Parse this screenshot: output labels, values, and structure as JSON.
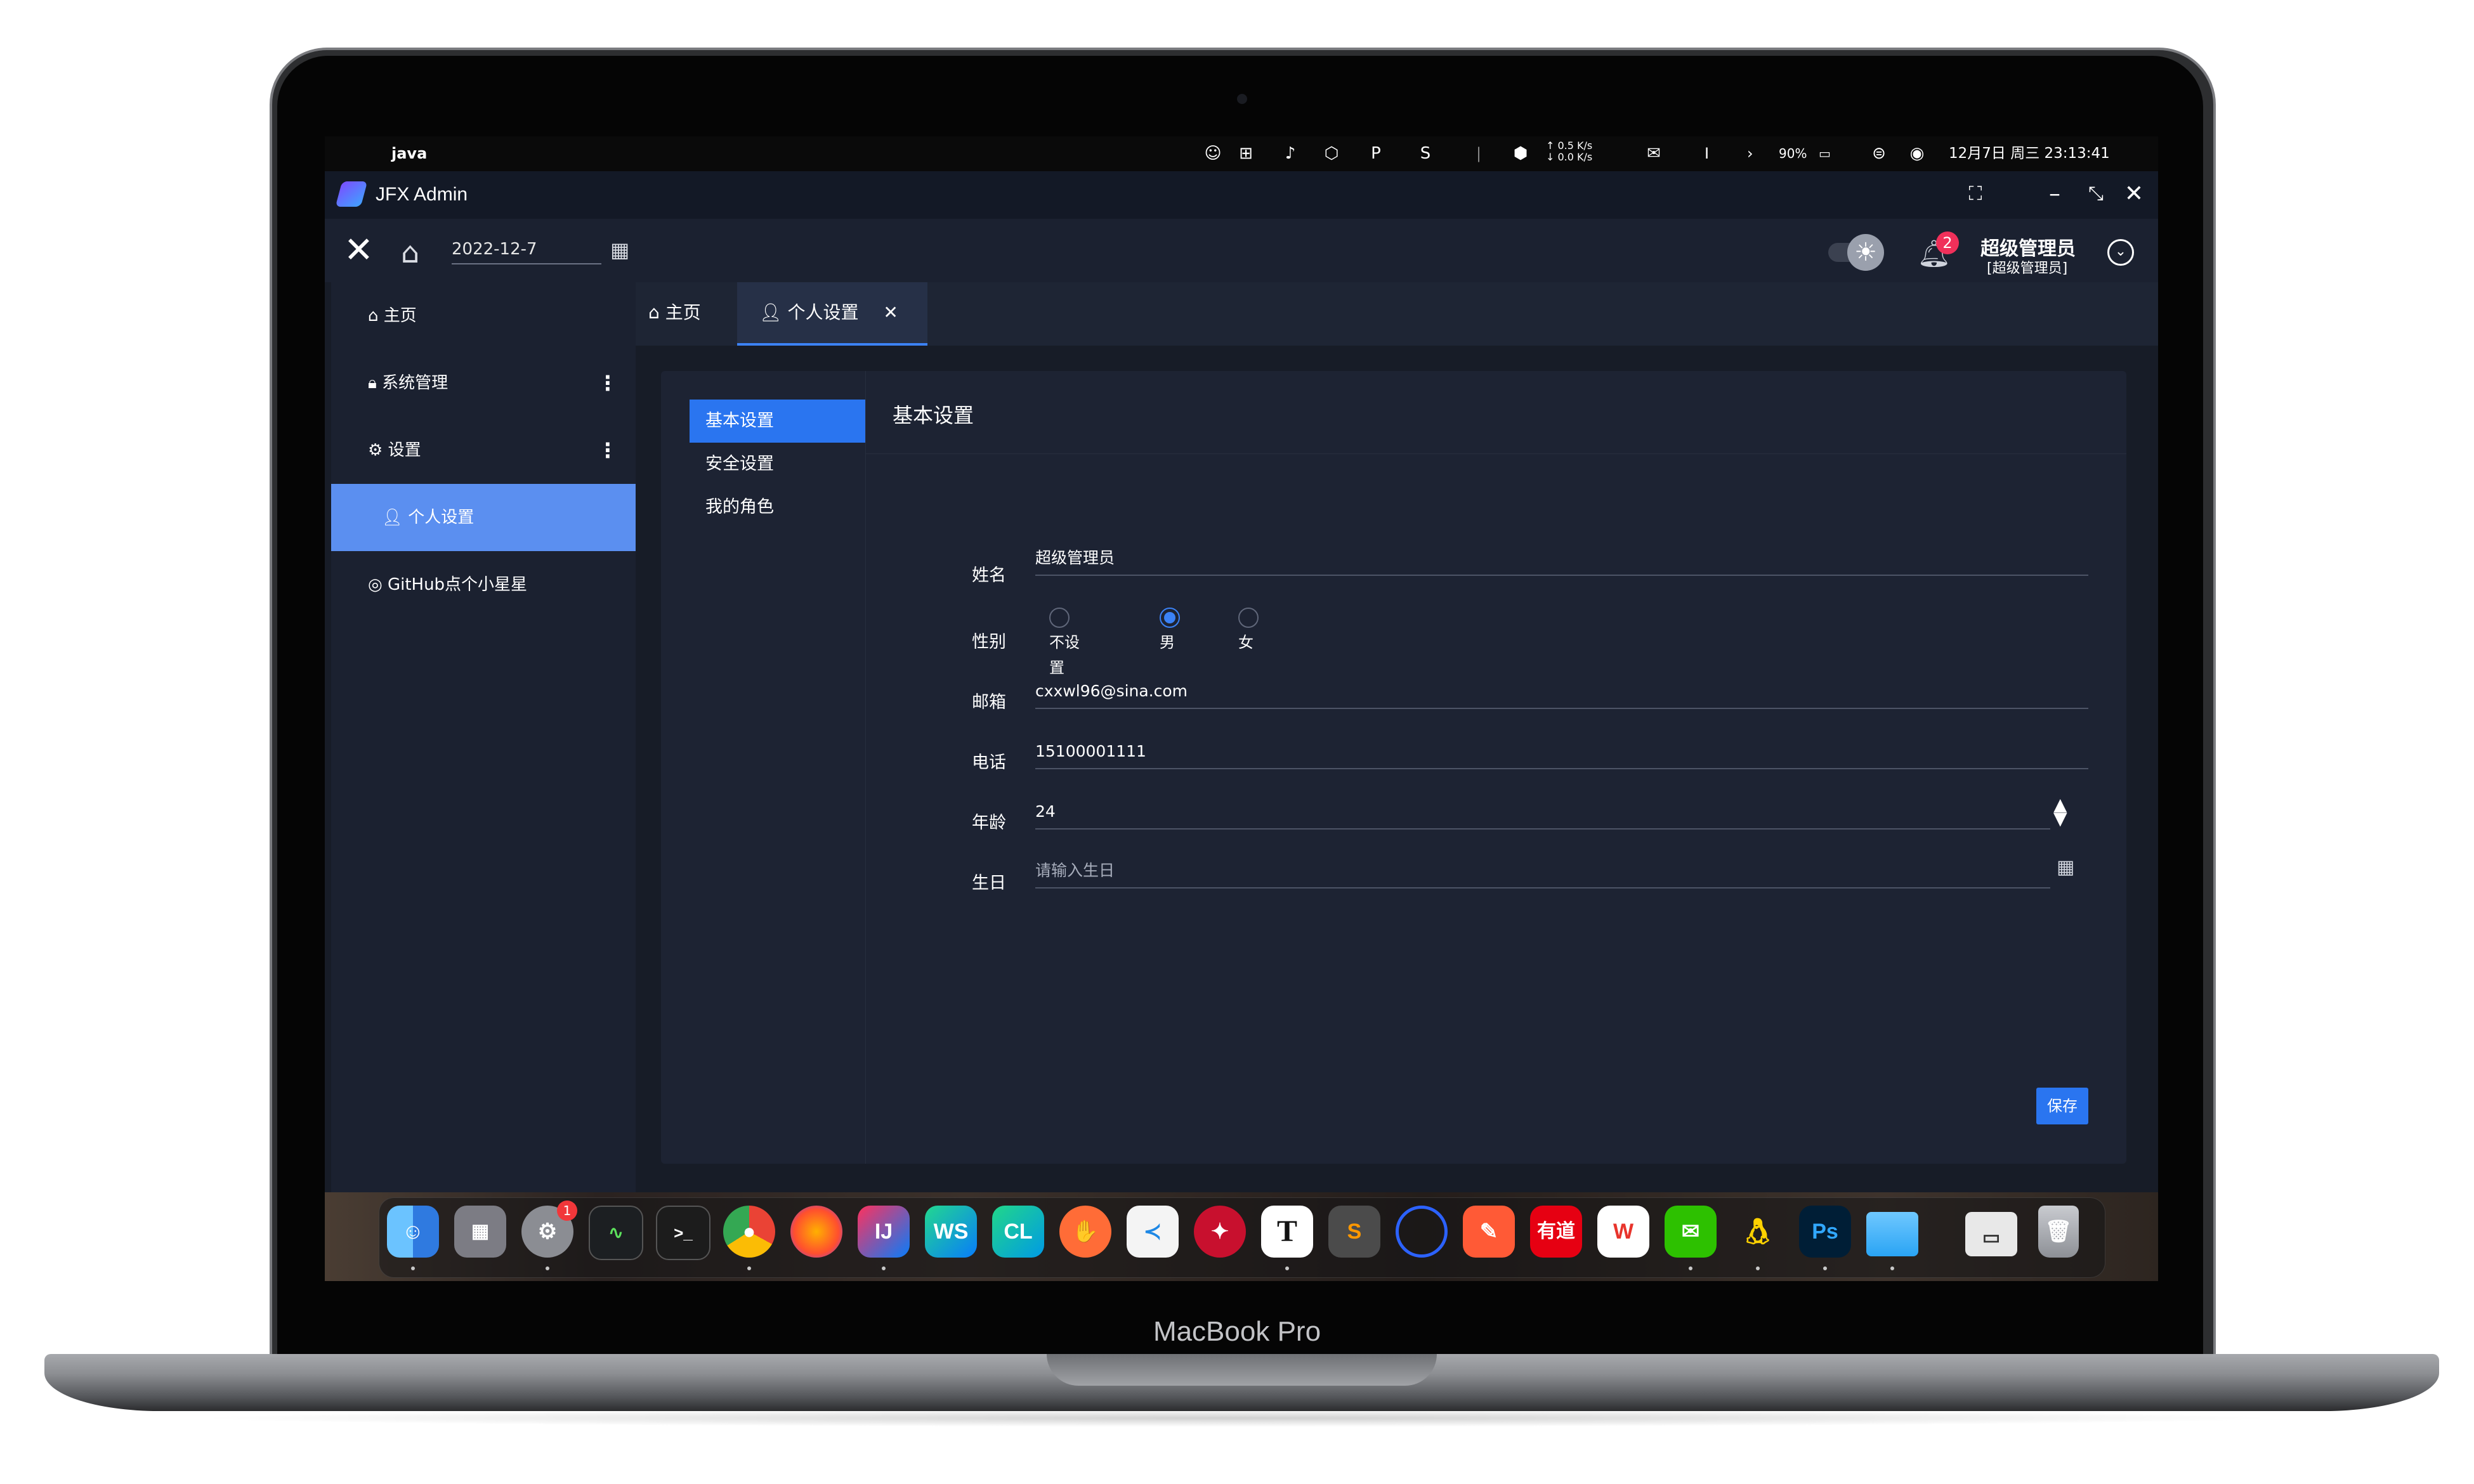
{
  "device": {
    "label": "MacBook Pro"
  },
  "menubar": {
    "app_name": "java",
    "net_up": "↑ 0.5 K/s",
    "net_down": "↓ 0.0 K/s",
    "battery": "90%",
    "datetime": "12月7日 周三 23:13:41"
  },
  "window": {
    "title": "JFX Admin"
  },
  "toolbar": {
    "date_value": "2022-12-7",
    "notification_count": "2",
    "user_name": "超级管理员",
    "user_role": "[超级管理员]"
  },
  "sidebar": {
    "items": [
      {
        "label": "主页"
      },
      {
        "label": "系统管理"
      },
      {
        "label": "设置"
      },
      {
        "label": "个人设置"
      },
      {
        "label": "GitHub点个小星星"
      }
    ]
  },
  "tabs": [
    {
      "label": "主页"
    },
    {
      "label": "个人设置"
    }
  ],
  "subnav": [
    {
      "label": "基本设置"
    },
    {
      "label": "安全设置"
    },
    {
      "label": "我的角色"
    }
  ],
  "form": {
    "section_title": "基本设置",
    "name": {
      "label": "姓名",
      "value": "超级管理员"
    },
    "gender": {
      "label": "性别",
      "options": [
        "不设置",
        "男",
        "女"
      ],
      "selected": "男"
    },
    "email": {
      "label": "邮箱",
      "value": "cxxwl96@sina.com"
    },
    "phone": {
      "label": "电话",
      "value": "15100001111"
    },
    "age": {
      "label": "年龄",
      "value": "24"
    },
    "birthday": {
      "label": "生日",
      "placeholder": "请输入生日"
    },
    "save_label": "保存"
  },
  "dock": {
    "settings_badge": "1",
    "apps": [
      "finder",
      "launchpad",
      "system-preferences",
      "activity-monitor",
      "terminal",
      "chrome",
      "firefox",
      "intellij-idea",
      "webstorm",
      "clion",
      "postman",
      "vscode",
      "navicat",
      "typora",
      "sublime-text",
      "eclipse",
      "pencil",
      "youdao",
      "wps",
      "wechat",
      "qq",
      "photoshop",
      "files",
      "window-manager",
      "trash"
    ],
    "labels": {
      "intellij": "IJ",
      "webstorm": "WS",
      "clion": "CL",
      "typora": "T",
      "youdao": "有道",
      "wps": "W",
      "photoshop": "Ps"
    }
  },
  "colors": {
    "accent": "#2a75f0",
    "sidebar_active": "#5b8ff0",
    "background": "#171c27",
    "badge": "#f0305a"
  }
}
